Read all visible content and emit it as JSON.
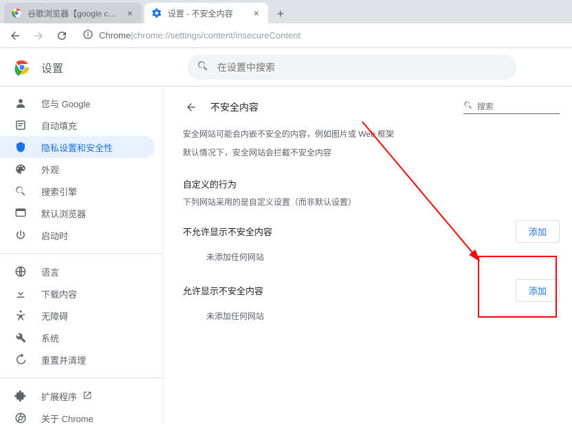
{
  "tabs": [
    {
      "title": "谷歌浏览器【google chrome】"
    },
    {
      "title": "设置 - 不安全内容"
    }
  ],
  "omnibox": {
    "prefix": "Chrome",
    "sep": " | ",
    "url": "chrome://settings/content/insecureContent"
  },
  "header": {
    "title": "设置",
    "search_placeholder": "在设置中搜索"
  },
  "sidebar": {
    "items": [
      {
        "label": "您与 Google"
      },
      {
        "label": "自动填充"
      },
      {
        "label": "隐私设置和安全性"
      },
      {
        "label": "外观"
      },
      {
        "label": "搜索引擎"
      },
      {
        "label": "默认浏览器"
      },
      {
        "label": "启动时"
      }
    ],
    "items2": [
      {
        "label": "语言"
      },
      {
        "label": "下载内容"
      },
      {
        "label": "无障碍"
      },
      {
        "label": "系统"
      },
      {
        "label": "重置并清理"
      }
    ],
    "items3": [
      {
        "label": "扩展程序"
      },
      {
        "label": "关于 Chrome"
      }
    ]
  },
  "content": {
    "title": "不安全内容",
    "search_placeholder": "搜索",
    "desc1": "安全网站可能会内嵌不安全的内容，例如图片或 Web 框架",
    "desc2": "默认情况下，安全网站会拦截不安全内容",
    "custom_title": "自定义的行为",
    "custom_sub": "下列网站采用的是自定义设置（而非默认设置）",
    "block_label": "不允许显示不安全内容",
    "allow_label": "允许显示不安全内容",
    "empty": "未添加任何网站",
    "add": "添加"
  }
}
